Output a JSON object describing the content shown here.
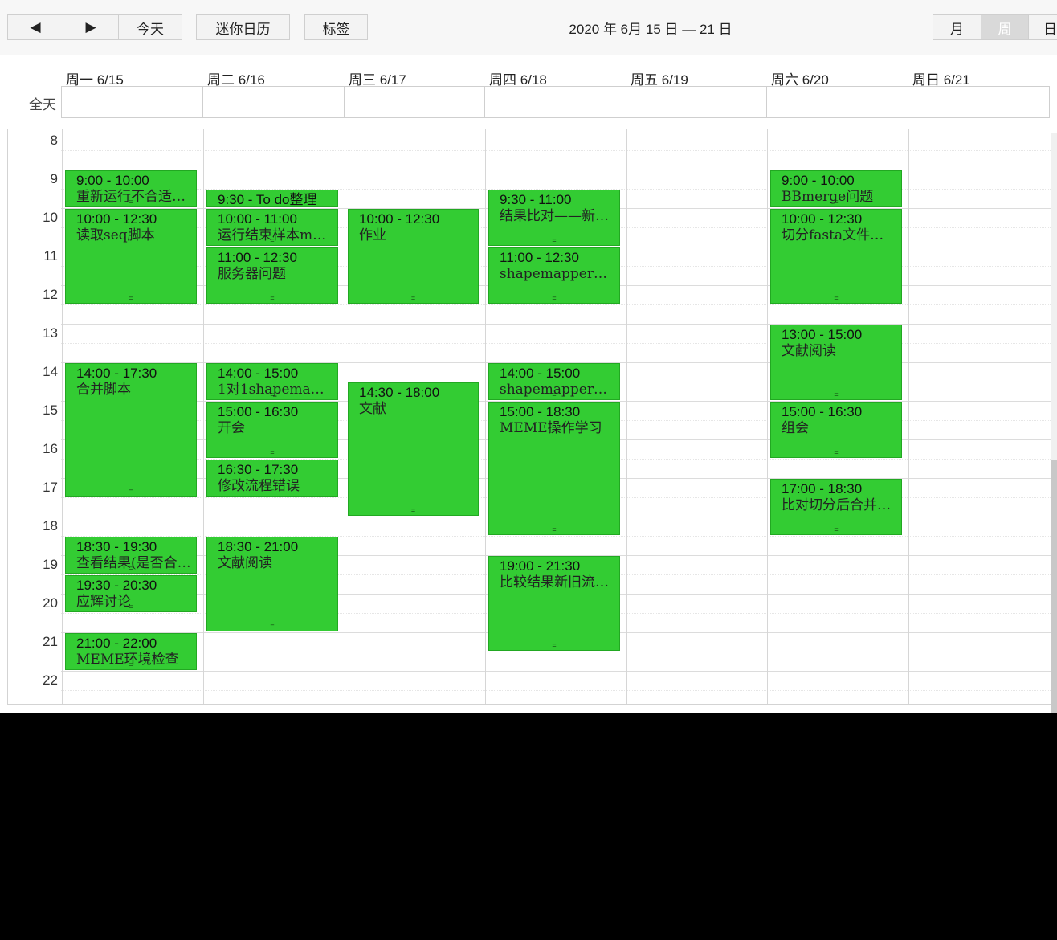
{
  "toolbar": {
    "prev_icon": "◀",
    "next_icon": "▶",
    "today_label": "今天",
    "mini_calendar_label": "迷你日历",
    "tags_label": "标签",
    "range_title": "2020 年 6月 15 日 — 21 日",
    "view_month_label": "月",
    "view_week_label": "周",
    "view_day_label": "日"
  },
  "allday_label": "全天",
  "days": [
    "周一 6/15",
    "周二 6/16",
    "周三 6/17",
    "周四 6/18",
    "周五 6/19",
    "周六 6/20",
    "周日 6/21"
  ],
  "hours": [
    "8",
    "9",
    "10",
    "11",
    "12",
    "13",
    "14",
    "15",
    "16",
    "17",
    "18",
    "19",
    "20",
    "21",
    "22"
  ],
  "event_color": "#33cc33",
  "events": [
    {
      "day": 0,
      "start": 9,
      "end": 10,
      "time": "9:00 - 10:00",
      "title": "重新运行不合适…"
    },
    {
      "day": 0,
      "start": 10,
      "end": 12.5,
      "time": "10:00 - 12:30",
      "title": "读取seq脚本"
    },
    {
      "day": 0,
      "start": 14,
      "end": 17.5,
      "time": "14:00 - 17:30",
      "title": "合并脚本"
    },
    {
      "day": 0,
      "start": 18.5,
      "end": 19.5,
      "time": "18:30 - 19:30",
      "title": "查看结果(是否合…"
    },
    {
      "day": 0,
      "start": 19.5,
      "end": 20.5,
      "time": "19:30 - 20:30",
      "title": "应辉讨论"
    },
    {
      "day": 0,
      "start": 21,
      "end": 22,
      "time": "21:00 - 22:00",
      "title": "MEME环境检查"
    },
    {
      "day": 1,
      "start": 9.5,
      "end": 10,
      "time": "9:30 - To do整理",
      "title": ""
    },
    {
      "day": 1,
      "start": 10,
      "end": 11,
      "time": "10:00 - 11:00",
      "title": "运行结束样本m…"
    },
    {
      "day": 1,
      "start": 11,
      "end": 12.5,
      "time": "11:00 - 12:30",
      "title": "服务器问题"
    },
    {
      "day": 1,
      "start": 14,
      "end": 15,
      "time": "14:00 - 15:00",
      "title": "1对1shapemap…"
    },
    {
      "day": 1,
      "start": 15,
      "end": 16.5,
      "time": "15:00 - 16:30",
      "title": "开会"
    },
    {
      "day": 1,
      "start": 16.5,
      "end": 17.5,
      "time": "16:30 - 17:30",
      "title": "修改流程错误"
    },
    {
      "day": 1,
      "start": 18.5,
      "end": 21,
      "time": "18:30 - 21:00",
      "title": "文献阅读"
    },
    {
      "day": 2,
      "start": 10,
      "end": 12.5,
      "time": "10:00 - 12:30",
      "title": "作业"
    },
    {
      "day": 2,
      "start": 14.5,
      "end": 18,
      "time": "14:30 - 18:00",
      "title": "文献"
    },
    {
      "day": 3,
      "start": 9.5,
      "end": 11,
      "time": "9:30 - 11:00",
      "title": "结果比对——新…"
    },
    {
      "day": 3,
      "start": 11,
      "end": 12.5,
      "time": "11:00 - 12:30",
      "title": "shapemapper旧…"
    },
    {
      "day": 3,
      "start": 14,
      "end": 15,
      "time": "14:00 - 15:00",
      "title": "shapemapper旧…"
    },
    {
      "day": 3,
      "start": 15,
      "end": 18.5,
      "time": "15:00 - 18:30",
      "title": "MEME操作学习"
    },
    {
      "day": 3,
      "start": 19,
      "end": 21.5,
      "time": "19:00 - 21:30",
      "title": "比较结果新旧流…"
    },
    {
      "day": 5,
      "start": 9,
      "end": 10,
      "time": "9:00 - 10:00",
      "title": "BBmerge问题"
    },
    {
      "day": 5,
      "start": 10,
      "end": 12.5,
      "time": "10:00 - 12:30",
      "title": "切分fasta文件测…"
    },
    {
      "day": 5,
      "start": 13,
      "end": 15,
      "time": "13:00 - 15:00",
      "title": "文献阅读"
    },
    {
      "day": 5,
      "start": 15,
      "end": 16.5,
      "time": "15:00 - 16:30",
      "title": "组会"
    },
    {
      "day": 5,
      "start": 17,
      "end": 18.5,
      "time": "17:00 - 18:30",
      "title": "比对切分后合并…"
    }
  ]
}
